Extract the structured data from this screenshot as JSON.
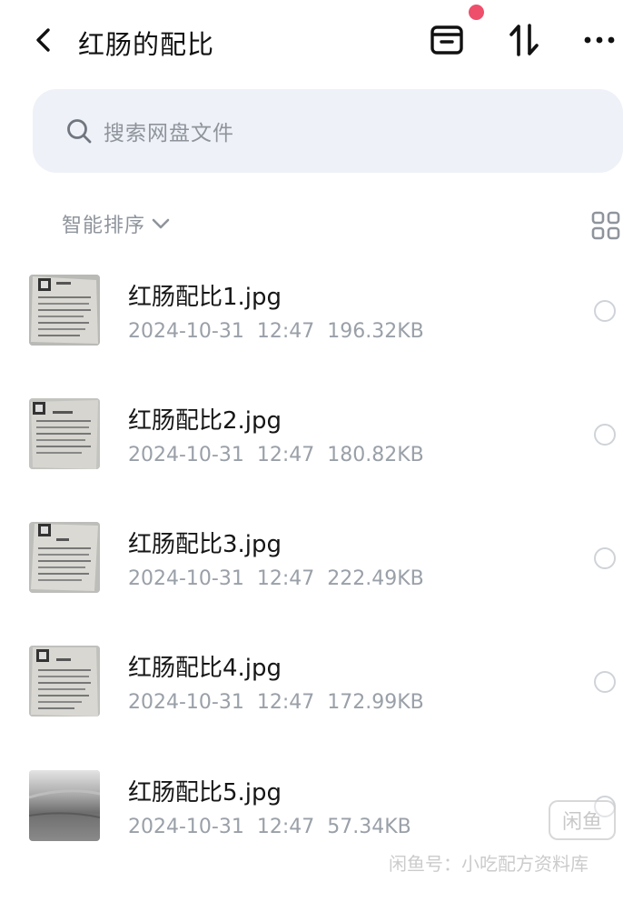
{
  "header": {
    "title": "红肠的配比",
    "back_icon": "chevron-left-icon",
    "icons": [
      "archive-box-icon",
      "sort-arrows-icon",
      "more-dots-icon"
    ],
    "notification_dot_color": "#ee4f6b"
  },
  "search": {
    "placeholder": "搜索网盘文件"
  },
  "sort": {
    "label": "智能排序"
  },
  "files": [
    {
      "name": "红肠配比1.jpg",
      "date": "2024-10-31",
      "time": "12:47",
      "size": "196.32KB"
    },
    {
      "name": "红肠配比2.jpg",
      "date": "2024-10-31",
      "time": "12:47",
      "size": "180.82KB"
    },
    {
      "name": "红肠配比3.jpg",
      "date": "2024-10-31",
      "time": "12:47",
      "size": "222.49KB"
    },
    {
      "name": "红肠配比4.jpg",
      "date": "2024-10-31",
      "time": "12:47",
      "size": "172.99KB"
    },
    {
      "name": "红肠配比5.jpg",
      "date": "2024-10-31",
      "time": "12:47",
      "size": "57.34KB"
    }
  ],
  "watermark": {
    "logo": "闲鱼",
    "text": "闲鱼号：小吃配方资料库"
  }
}
